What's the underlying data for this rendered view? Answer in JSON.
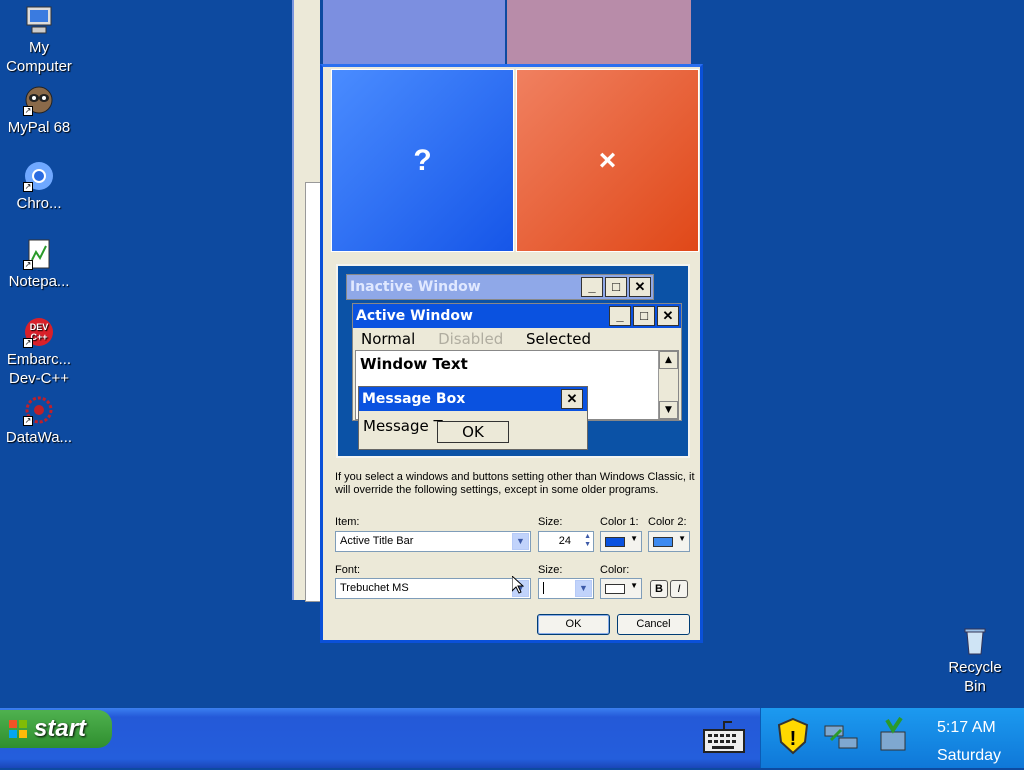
{
  "desktop": {
    "icons": [
      {
        "label_line1": "My",
        "label_line2": "Computer",
        "icon": "my-computer-icon"
      },
      {
        "label_line1": "MyPal 68",
        "label_line2": "",
        "icon": "mypal-icon"
      },
      {
        "label_line1": "Chro...",
        "label_line2": "",
        "icon": "chrome-icon"
      },
      {
        "label_line1": "Notepa...",
        "label_line2": "",
        "icon": "notepad-icon"
      },
      {
        "label_line1": "Embarc...",
        "label_line2": "Dev-C++",
        "icon": "devcpp-icon"
      },
      {
        "label_line1": "DataWa...",
        "label_line2": "",
        "icon": "datawarrior-icon"
      }
    ],
    "recycle_bin": {
      "line1": "Recycle",
      "line2": "Bin"
    }
  },
  "dialog": {
    "big_buttons": {
      "help": "?",
      "close": "×"
    },
    "preview": {
      "inactive_title": "Inactive Window",
      "active_title": "Active Window",
      "menu_normal": "Normal",
      "menu_disabled": "Disabled",
      "menu_selected": "Selected",
      "window_text": "Window Text",
      "message_box_title": "Message Box",
      "message_text": "Message T",
      "ok": "OK"
    },
    "info_text": "If you select a windows and buttons setting other than Windows Classic, it will override the following settings, except in some older programs.",
    "labels": {
      "item": "Item:",
      "size": "Size:",
      "color1": "Color 1:",
      "color2": "Color 2:",
      "font": "Font:",
      "font_size": "Size:",
      "font_color": "Color:"
    },
    "values": {
      "item": "Active Title Bar",
      "size": "24",
      "font": "Trebuchet MS",
      "font_size": ""
    },
    "colors": {
      "color1": "#0a52e0",
      "color2": "#3d8af0",
      "font_color": "#ffffff"
    },
    "format": {
      "bold": "B",
      "italic": "I"
    },
    "ok_label": "OK",
    "cancel_label": "Cancel"
  },
  "taskbar": {
    "start_label": "start",
    "clock_time": "5:17 AM",
    "clock_day": "Saturday"
  }
}
